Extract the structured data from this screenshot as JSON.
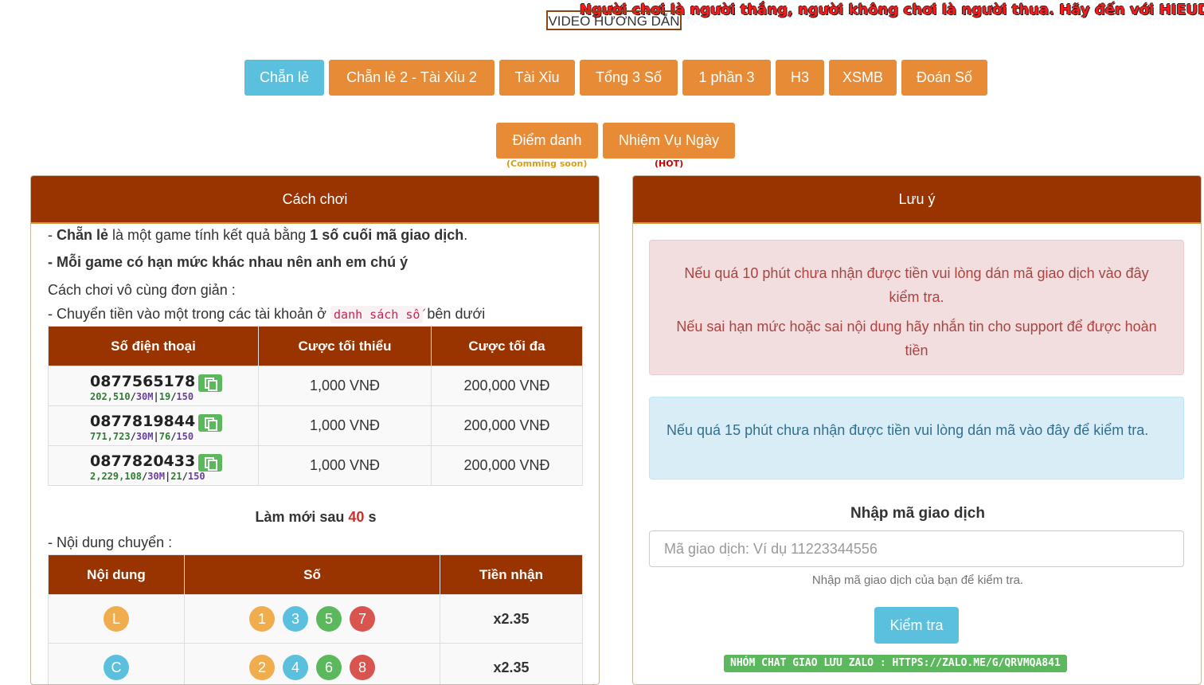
{
  "marquee_text": "Người chơi là người thắng, người không chơi là người thua. Hãy đến với HIEUDT.GI",
  "video_button": "VIDEO HƯỚNG DẪN",
  "game_tabs": [
    {
      "label": "Chẵn lẻ",
      "active": true
    },
    {
      "label": "Chẵn lẻ 2 - Tài Xỉu 2",
      "active": false
    },
    {
      "label": "Tài Xỉu",
      "active": false
    },
    {
      "label": "Tổng 3 Số",
      "active": false
    },
    {
      "label": "1 phần 3",
      "active": false
    },
    {
      "label": "H3",
      "active": false
    },
    {
      "label": "XSMB",
      "active": false
    },
    {
      "label": "Đoán Số",
      "active": false
    }
  ],
  "extra_buttons": [
    {
      "label": "Điểm danh",
      "note": "(Comming soon)",
      "note_color": "#d4a017"
    },
    {
      "label": "Nhiệm Vụ Ngày",
      "note": "(HOT)",
      "note_color": "#cc0000"
    }
  ],
  "how_to": {
    "title": "Cách chơi",
    "line1_prefix": "- ",
    "line1_bold1": "Chẵn lẻ",
    "line1_mid": " là một game tính kết quả bằng ",
    "line1_bold2": "1 số cuối mã giao dịch",
    "line1_end": ".",
    "line2": "- Mỗi game có hạn mức khác nhau nên anh em chú ý",
    "line3": "Cách chơi vô cùng đơn giản :",
    "line4_prefix": "- Chuyển tiền vào một trong các tài khoản ở",
    "line4_code": "danh sách số",
    "line4_suffix": "bên dưới",
    "accounts_headers": [
      "Số điện thoại",
      "Cược tối thiểu",
      "Cược tối đa"
    ],
    "accounts": [
      {
        "phone": "0877565178",
        "stat_amount": "202,510",
        "stat_limit": "30M",
        "stat_count": "19",
        "stat_max": "150",
        "min": "1,000 VNĐ",
        "max": "200,000 VNĐ"
      },
      {
        "phone": "0877819844",
        "stat_amount": "771,723",
        "stat_limit": "30M",
        "stat_count": "76",
        "stat_max": "150",
        "min": "1,000 VNĐ",
        "max": "200,000 VNĐ"
      },
      {
        "phone": "0877820433",
        "stat_amount": "2,229,108",
        "stat_limit": "30M",
        "stat_count": "21",
        "stat_max": "150",
        "min": "1,000 VNĐ",
        "max": "200,000 VNĐ"
      }
    ],
    "refresh_label": "Làm mới sau",
    "refresh_value": "40",
    "refresh_unit": "s",
    "content_label": "- Nội dung chuyển :",
    "content_headers": [
      "Nội dung",
      "Số",
      "Tiền nhận"
    ],
    "content_rows": [
      {
        "code": "L",
        "code_color": "#f0ad4e",
        "numbers": [
          "1",
          "3",
          "5",
          "7"
        ],
        "number_colors": [
          "#f0ad4e",
          "#5bc0de",
          "#5cb85c",
          "#d9534f"
        ],
        "payout": "x2.35"
      },
      {
        "code": "C",
        "code_color": "#5bc0de",
        "numbers": [
          "2",
          "4",
          "6",
          "8"
        ],
        "number_colors": [
          "#f0ad4e",
          "#5bc0de",
          "#5cb85c",
          "#d9534f"
        ],
        "payout": "x2.35"
      }
    ]
  },
  "notes": {
    "title": "Lưu ý",
    "red_line1": "Nếu quá 10 phút chưa nhận được tiền vui lòng dán mã giao dịch vào đây kiểm tra.",
    "red_line2": "Nếu sai hạn mức hoặc sai nội dung hãy nhắn tin cho support để được hoàn tiền",
    "blue_text": "Nếu quá 15 phút chưa nhận được tiền vui lòng dán mã vào đây để kiểm tra.",
    "input_label": "Nhập mã giao dịch",
    "input_placeholder": "Mã giao dịch: Ví dụ 11223344556",
    "input_help": "Nhập mã giao dịch của bạn để kiểm tra.",
    "check_button": "Kiểm tra",
    "zalo_text": "NHÓM CHAT GIAO LƯU ZALO : HTTPS://ZALO.ME/G/QRVMQA841"
  },
  "colors": {
    "header_brown": "#993300",
    "tab_orange": "#e88b36",
    "tab_active": "#5bc0de"
  }
}
